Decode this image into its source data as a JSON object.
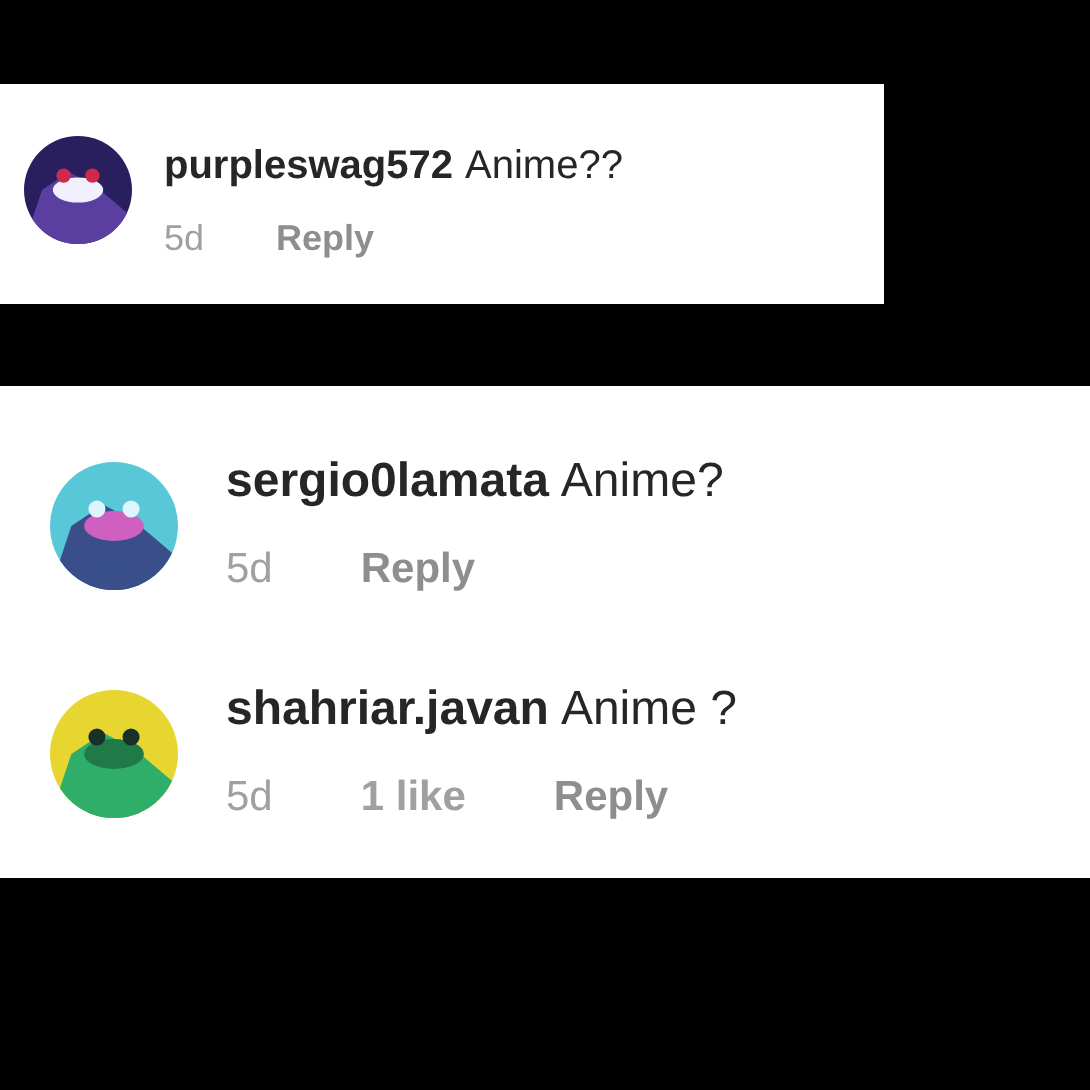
{
  "cards": [
    {
      "comments": [
        {
          "username": "purpleswag572",
          "text": "Anime??",
          "time": "5d",
          "reply": "Reply"
        }
      ]
    },
    {
      "comments": [
        {
          "username": "sergio0lamata",
          "text": "Anime?",
          "time": "5d",
          "reply": "Reply"
        },
        {
          "username": "shahriar.javan",
          "text": "Anime ?",
          "time": "5d",
          "likes": "1 like",
          "reply": "Reply"
        }
      ]
    }
  ]
}
